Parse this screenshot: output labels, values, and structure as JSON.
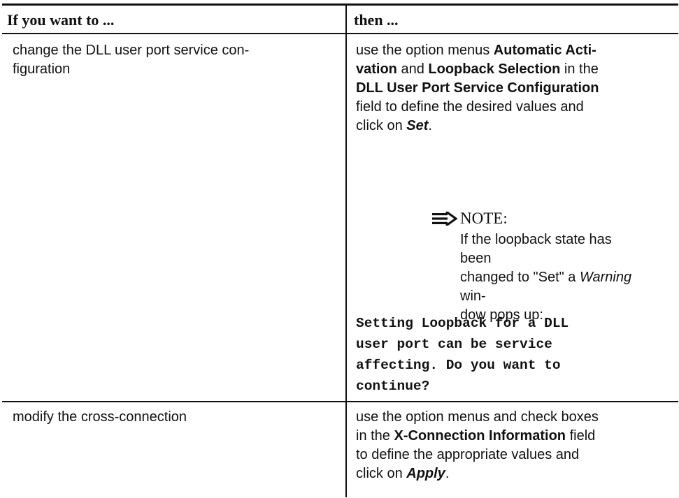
{
  "table": {
    "headers": {
      "col1": "If you want to ...",
      "col2": "then ..."
    },
    "rows": [
      {
        "condition_lines": [
          "change the DLL user port service con-",
          "figuration"
        ],
        "action_lines": {
          "l1_pre": "use the option menus ",
          "l1_bold": "Automatic Acti-",
          "l2_bold1": "vation",
          "l2_mid": " and ",
          "l2_bold2": "Loopback Selection",
          "l2_post": " in the",
          "l3_bold": "DLL User Port Service Configuration",
          "l4": "field to define the desired values and",
          "l5_pre": "click on ",
          "l5_bolditalic": "Set",
          "l5_post": "."
        },
        "note": {
          "icon": "right-arrow-icon",
          "label": "NOTE:",
          "l1": "If the loopback state has been",
          "l2_pre": "changed to \"Set\" a ",
          "l2_italic": "Warning",
          "l2_post": " win-",
          "l3": "dow pops up:"
        },
        "warning_message_lines": [
          "Setting Loopback for a DLL",
          "user port can be service",
          "affecting. Do you want to",
          "continue?"
        ]
      },
      {
        "condition_lines": [
          "modify the cross-connection"
        ],
        "action_lines": {
          "l1": "use the option menus and check boxes",
          "l2_pre": "in the ",
          "l2_bold": "X-Connection Information",
          "l2_post": " field",
          "l3": "to define the appropriate values and",
          "l4_pre": "click on ",
          "l4_bolditalic": "Apply",
          "l4_post": "."
        }
      }
    ]
  }
}
